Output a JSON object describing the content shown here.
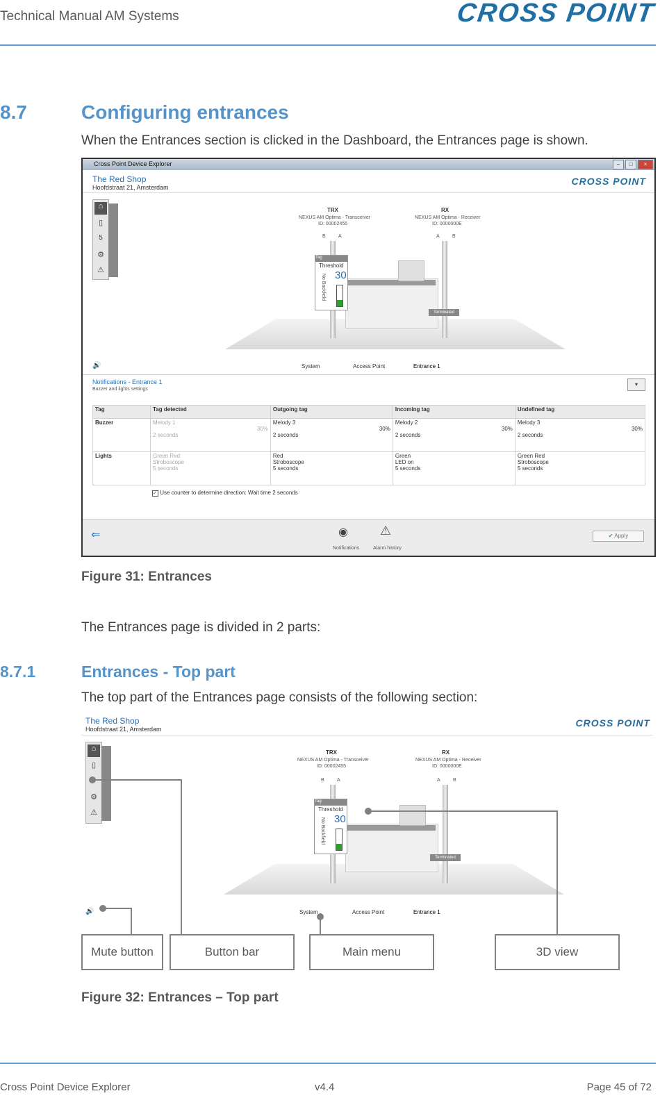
{
  "header": {
    "doc_title": "Technical Manual AM Systems",
    "logo_text": "CROSS POINT"
  },
  "section": {
    "number": "8.7",
    "title": "Configuring entrances",
    "intro": "When the Entrances section is clicked in the Dashboard, the Entrances page is shown."
  },
  "figure31": {
    "window_title": "Cross Point Device Explorer",
    "shop_name": "The Red Shop",
    "shop_address": "Hoofdstraat 21, Amsterdam",
    "logo_text": "CROSS POINT",
    "trx": {
      "name": "TRX",
      "model": "NEXUS AM Optima - Transceiver",
      "id": "ID: 00002455",
      "b": "B",
      "a": "A"
    },
    "rx": {
      "name": "RX",
      "model": "NEXUS AM Optima - Receiver",
      "id": "ID: 0000000E",
      "a": "A",
      "b": "B"
    },
    "tag_label": "Tag",
    "threshold_label": "Threshold",
    "threshold_value": "30",
    "no_backfield": "No Backfield",
    "terminated": "Terminated",
    "menu": {
      "system": "System",
      "access_point": "Access Point",
      "entrance": "Entrance 1"
    },
    "notifications_title": "Notifications - Entrance 1",
    "notifications_sub": "Buzzer and lights settings",
    "table": {
      "headers": [
        "Tag",
        "Tag detected",
        "Outgoing tag",
        "Incoming tag",
        "Undefined tag"
      ],
      "buzzer_label": "Buzzer",
      "lights_label": "Lights",
      "buzzer": [
        {
          "melody": "Melody 1",
          "volume": "30%",
          "duration": "2 seconds"
        },
        {
          "melody": "Melody 3",
          "volume": "30%",
          "duration": "2 seconds"
        },
        {
          "melody": "Melody 2",
          "volume": "30%",
          "duration": "2 seconds"
        },
        {
          "melody": "Melody 3",
          "volume": "30%",
          "duration": "2 seconds"
        }
      ],
      "lights": [
        {
          "color": "Green Red",
          "mode": "Stroboscope",
          "duration": "5 seconds"
        },
        {
          "color": "Red",
          "mode": "Stroboscope",
          "duration": "5 seconds"
        },
        {
          "color": "Green",
          "mode": "LED on",
          "duration": "5 seconds"
        },
        {
          "color": "Green Red",
          "mode": "Stroboscope",
          "duration": "5 seconds"
        }
      ],
      "counter_text": "Use counter to determine direction: Wait time",
      "wait_time": "2 seconds"
    },
    "bottom": {
      "notifications": "Notifications",
      "alarm_history": "Alarm history",
      "apply": "Apply"
    },
    "caption": "Figure 31: Entrances"
  },
  "parts_text": "The Entrances page is divided in 2 parts:",
  "subsection": {
    "number": "8.7.1",
    "title": "Entrances - Top part",
    "intro": "The top part of the Entrances page consists of the following section:"
  },
  "figure32": {
    "callouts": {
      "mute": "Mute button",
      "button_bar": "Button bar",
      "main_menu": "Main menu",
      "view3d": "3D view"
    },
    "caption": "Figure 32: Entrances – Top part"
  },
  "footer": {
    "left": "Cross Point Device Explorer",
    "center": "v4.4",
    "right": "Page 45 of 72"
  },
  "colors": {
    "heading": "#5593c8",
    "rule": "#5b9bd5",
    "logo": "#1f6fa4"
  }
}
